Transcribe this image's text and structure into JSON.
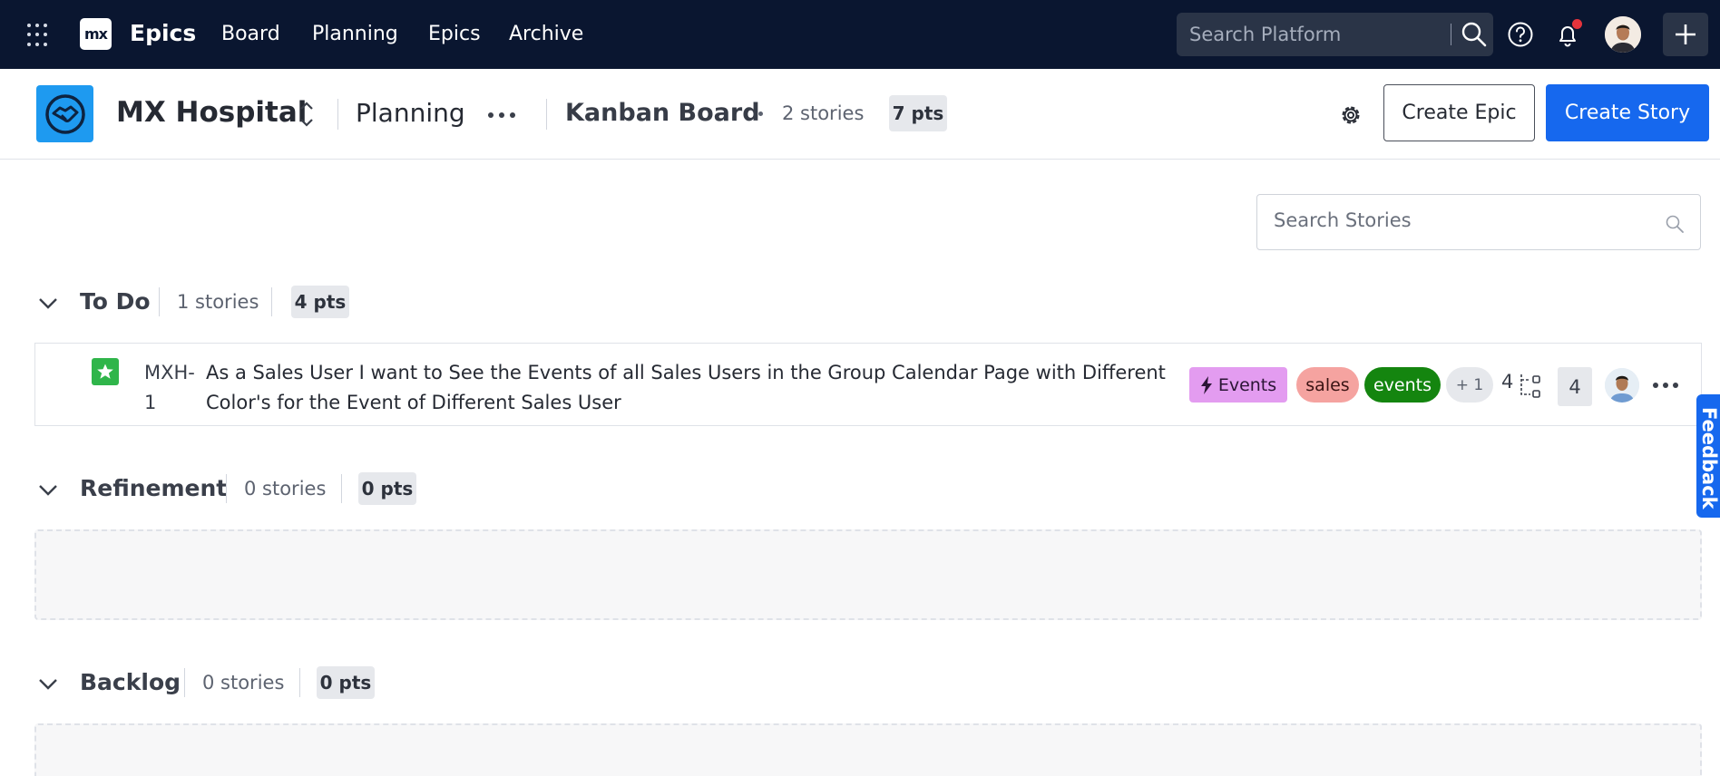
{
  "topnav": {
    "logo_text": "mx",
    "app_name": "Epics",
    "links": [
      "Board",
      "Planning",
      "Epics",
      "Archive"
    ],
    "search_placeholder": "Search Platform"
  },
  "subheader": {
    "project_name": "MX Hospital",
    "view_name": "Planning",
    "board_name": "Kanban Board",
    "stories_count": "2 stories",
    "points": "7 pts",
    "create_epic_label": "Create Epic",
    "create_story_label": "Create Story"
  },
  "search_stories": {
    "placeholder": "Search Stories"
  },
  "sections": [
    {
      "title": "To Do",
      "stories": "1 stories",
      "points": "4 pts",
      "items": [
        {
          "key": "MXH-1",
          "title": "As a Sales User I want to See the Events of all Sales Users in the Group Calendar Page with Different Color's for the Event of Different Sales User",
          "epic": "Events",
          "labels": [
            "sales",
            "events"
          ],
          "more_labels": "+ 1",
          "subtasks": "4",
          "estimate": "4"
        }
      ]
    },
    {
      "title": "Refinement",
      "stories": "0 stories",
      "points": "0 pts",
      "items": []
    },
    {
      "title": "Backlog",
      "stories": "0 stories",
      "points": "0 pts",
      "items": []
    }
  ],
  "feedback_label": "Feedback",
  "colors": {
    "nav_bg": "#0a1630",
    "primary": "#1668ee",
    "project_icon": "#1e9af0",
    "story_type": "#2fb54a",
    "epic_tag": "#e39cf0",
    "sales_tag": "#f5a3a0",
    "events_tag": "#14850f"
  }
}
